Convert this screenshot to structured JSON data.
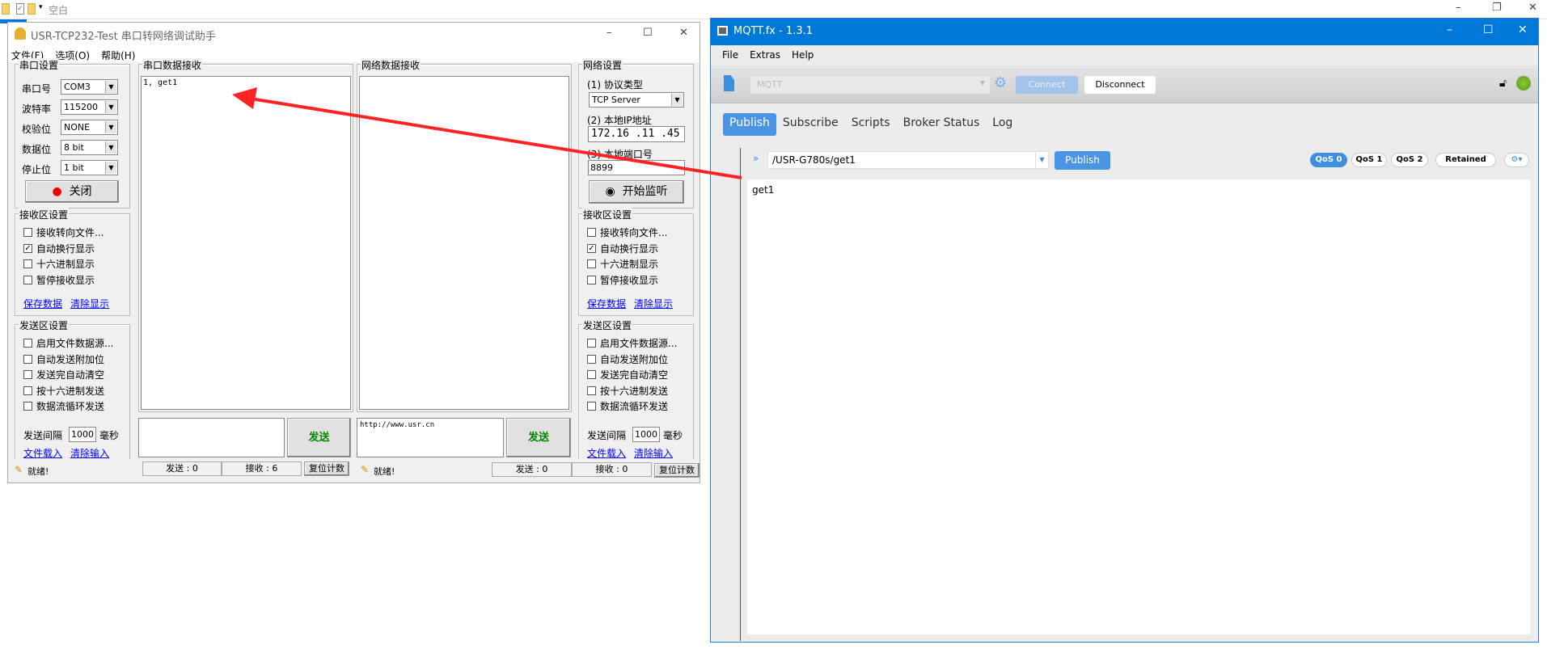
{
  "desktop": {
    "path_label": "空白"
  },
  "usr": {
    "title": "USR-TCP232-Test 串口转网络调试助手",
    "menu": [
      "文件(F)",
      "选项(O)",
      "帮助(H)"
    ],
    "serial_settings": {
      "title": "串口设置",
      "fields": [
        {
          "label": "串口号",
          "value": "COM3"
        },
        {
          "label": "波特率",
          "value": "115200"
        },
        {
          "label": "校验位",
          "value": "NONE"
        },
        {
          "label": "数据位",
          "value": "8 bit"
        },
        {
          "label": "停止位",
          "value": "1 bit"
        }
      ],
      "close_button": "关闭"
    },
    "recv_settings": {
      "title": "接收区设置",
      "options": [
        {
          "label": "接收转向文件...",
          "checked": false
        },
        {
          "label": "自动换行显示",
          "checked": true
        },
        {
          "label": "十六进制显示",
          "checked": false
        },
        {
          "label": "暂停接收显示",
          "checked": false
        }
      ],
      "save_link": "保存数据",
      "clear_link": "清除显示"
    },
    "send_settings": {
      "title": "发送区设置",
      "options": [
        {
          "label": "启用文件数据源...",
          "checked": false
        },
        {
          "label": "自动发送附加位",
          "checked": false
        },
        {
          "label": "发送完自动清空",
          "checked": false
        },
        {
          "label": "按十六进制发送",
          "checked": false
        },
        {
          "label": "数据流循环发送",
          "checked": false
        }
      ],
      "interval_label": "发送间隔",
      "interval_value": "1000",
      "interval_unit": "毫秒",
      "load_link": "文件载入",
      "clear_link": "清除输入"
    },
    "serial_recv": {
      "title": "串口数据接收",
      "content": "1, get1"
    },
    "net_recv": {
      "title": "网络数据接收",
      "content": ""
    },
    "serial_send": {
      "value": "",
      "button": "发送"
    },
    "net_send": {
      "value": "http://www.usr.cn",
      "button": "发送"
    },
    "net_settings": {
      "title": "网络设置",
      "protocol_label": "(1) 协议类型",
      "protocol": "TCP Server",
      "ip_label": "(2) 本地IP地址",
      "ip": "172.16 .11 .45",
      "port_label": "(3) 本地端口号",
      "port": "8899",
      "listen_button": "开始监听"
    },
    "status_left": {
      "ready": "就绪!",
      "sent": "发送 : 0",
      "recv": "接收 : 6",
      "reset": "复位计数"
    },
    "status_right": {
      "ready": "就绪!",
      "sent": "发送 : 0",
      "recv": "接收 : 0",
      "reset": "复位计数"
    }
  },
  "mqtt": {
    "title": "MQTT.fx - 1.3.1",
    "menu": [
      "File",
      "Extras",
      "Help"
    ],
    "profile": "MQTT",
    "connect": "Connect",
    "disconnect": "Disconnect",
    "tabs": [
      "Publish",
      "Subscribe",
      "Scripts",
      "Broker Status",
      "Log"
    ],
    "active_tab": "Publish",
    "topic": "/USR-G780s/get1",
    "publish_button": "Publish",
    "qos": [
      "QoS 0",
      "QoS 1",
      "QoS 2"
    ],
    "active_qos": "QoS 0",
    "retained": "Retained",
    "payload": "get1",
    "colors": {
      "titlebar": "#0078d7",
      "accent": "#3d8fe0",
      "connected": "#6aa51c"
    }
  }
}
